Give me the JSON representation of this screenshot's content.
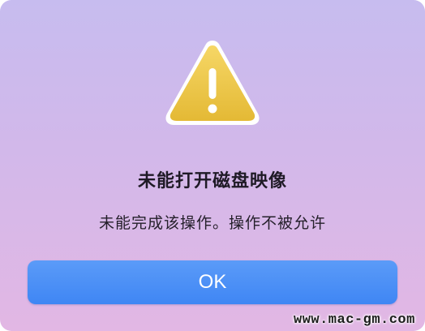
{
  "dialog": {
    "icon": "warning-triangle-icon",
    "title": "未能打开磁盘映像",
    "message": "未能完成该操作。操作不被允许",
    "ok_label": "OK",
    "colors": {
      "icon_fill": "#efc646",
      "button": "#4a8ff6",
      "button_text": "#ffffff"
    }
  },
  "watermark": {
    "text": "www.mac-gm.com"
  }
}
